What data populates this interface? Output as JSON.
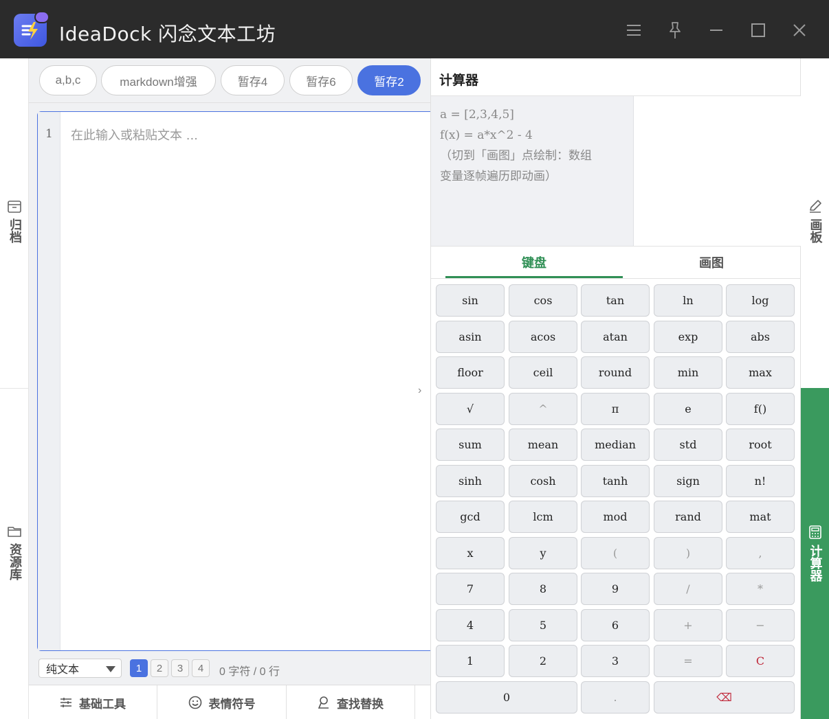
{
  "app": {
    "title": "IdeaDock 闪念文本工坊"
  },
  "left_rail": {
    "archive_label": "归档",
    "resources_label": "资源库"
  },
  "right_rail": {
    "board_label": "画板",
    "calculator_label": "计算器"
  },
  "tabs": [
    {
      "label": "a,b,c",
      "active": false
    },
    {
      "label": "markdown增强",
      "active": false
    },
    {
      "label": "暂存4",
      "active": false
    },
    {
      "label": "暂存6",
      "active": false
    },
    {
      "label": "暂存2",
      "active": true
    }
  ],
  "editor": {
    "line_number": "1",
    "placeholder": "在此输入或粘贴文本 ..."
  },
  "statusbar": {
    "mode": "纯文本",
    "pages": [
      "1",
      "2",
      "3",
      "4"
    ],
    "active_page": "1",
    "count_text": "0 字符 / 0 行"
  },
  "bottom_tools": {
    "basic": "基础工具",
    "emoji": "表情符号",
    "find_replace": "查找替换"
  },
  "calculator": {
    "title": "计算器",
    "input_lines": [
      "a = [2,3,4,5]",
      "f(x) = a*x^2 - 4",
      "（切到「画图」点绘制：数组",
      "变量逐帧遍历即动画）"
    ],
    "tabs": {
      "keyboard": "键盘",
      "plot": "画图"
    },
    "keys": [
      [
        "sin",
        "cos",
        "tan",
        "ln",
        "log"
      ],
      [
        "asin",
        "acos",
        "atan",
        "exp",
        "abs"
      ],
      [
        "floor",
        "ceil",
        "round",
        "min",
        "max"
      ],
      [
        "√",
        "^",
        "π",
        "e",
        "f()"
      ],
      [
        "sum",
        "mean",
        "median",
        "std",
        "root"
      ],
      [
        "sinh",
        "cosh",
        "tanh",
        "sign",
        "n!"
      ],
      [
        "gcd",
        "lcm",
        "mod",
        "rand",
        "mat"
      ],
      [
        "x",
        "y",
        "(",
        ")",
        ","
      ],
      [
        "7",
        "8",
        "9",
        "/",
        "*"
      ],
      [
        "4",
        "5",
        "6",
        "+",
        "−"
      ],
      [
        "1",
        "2",
        "3",
        "=",
        "C"
      ],
      [
        "0",
        ".",
        "⌫"
      ]
    ]
  },
  "colors": {
    "accent_blue": "#4a72e0",
    "accent_green": "#3a9a5e",
    "titlebar": "#2b2b2b",
    "clear_red": "#c0283a"
  },
  "icons": {
    "menu": "menu-icon",
    "pin": "pin-icon",
    "minimize": "minimize-icon",
    "maximize": "maximize-icon",
    "close": "close-icon"
  }
}
